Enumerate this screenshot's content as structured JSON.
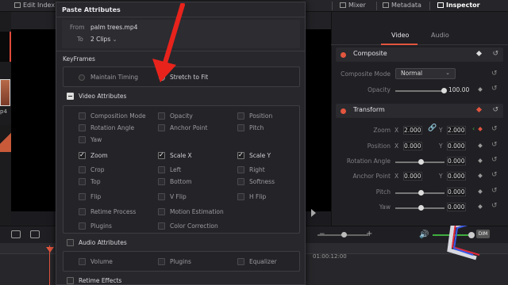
{
  "topbar": {
    "edit_index": "Edit Index",
    "mixer": "Mixer",
    "metadata": "Metadata",
    "inspector": "Inspector"
  },
  "media": {
    "clip_label": "p4"
  },
  "dialog": {
    "title": "Paste Attributes",
    "from_label": "From",
    "from_value": "palm trees.mp4",
    "to_label": "To",
    "to_value": "2 Clips",
    "keyframes_label": "KeyFrames",
    "keyframes_options": [
      {
        "label": "Maintain Timing",
        "selected": false
      },
      {
        "label": "Stretch to Fit",
        "selected": true
      }
    ],
    "video_attributes": {
      "title": "Video Attributes",
      "items": [
        {
          "label": "Composition Mode",
          "checked": false
        },
        {
          "label": "Opacity",
          "checked": false
        },
        {
          "label": "Position",
          "checked": false
        },
        {
          "label": "Rotation Angle",
          "checked": false
        },
        {
          "label": "Anchor Point",
          "checked": false
        },
        {
          "label": "Pitch",
          "checked": false
        },
        {
          "label": "Yaw",
          "checked": false
        },
        {
          "label": "Zoom",
          "checked": true
        },
        {
          "label": "Scale X",
          "checked": true
        },
        {
          "label": "Scale Y",
          "checked": true
        },
        {
          "label": "Crop",
          "checked": false
        },
        {
          "label": "Left",
          "checked": false
        },
        {
          "label": "Right",
          "checked": false
        },
        {
          "label": "Top",
          "checked": false
        },
        {
          "label": "Bottom",
          "checked": false
        },
        {
          "label": "Softness",
          "checked": false
        },
        {
          "label": "Flip",
          "checked": false
        },
        {
          "label": "V Flip",
          "checked": false
        },
        {
          "label": "H Flip",
          "checked": false
        },
        {
          "label": "Retime Process",
          "checked": false
        },
        {
          "label": "Motion Estimation",
          "checked": false
        },
        {
          "label": "Plugins",
          "checked": false
        },
        {
          "label": "Color Correction",
          "checked": false
        }
      ]
    },
    "audio_attributes": {
      "title": "Audio Attributes",
      "items": [
        {
          "label": "Volume",
          "checked": false
        },
        {
          "label": "Plugins",
          "checked": false
        },
        {
          "label": "Equalizer",
          "checked": false
        }
      ]
    },
    "retime_effects": "Retime Effects"
  },
  "inspector": {
    "tabs": [
      "Video",
      "Audio"
    ],
    "composite": {
      "title": "Composite",
      "mode_label": "Composite Mode",
      "mode_value": "Normal",
      "opacity_label": "Opacity",
      "opacity_value": "100.00"
    },
    "transform": {
      "title": "Transform",
      "zoom_label": "Zoom",
      "zoom_x": "2.000",
      "zoom_y": "2.000",
      "position_label": "Position",
      "position_x": "0.000",
      "position_y": "0.000",
      "rotation_label": "Rotation Angle",
      "rotation_value": "0.000",
      "anchor_label": "Anchor Point",
      "anchor_x": "0.000",
      "anchor_y": "0.000",
      "pitch_label": "Pitch",
      "pitch_value": "0.000",
      "yaw_label": "Yaw",
      "yaw_value": "0.000",
      "x": "X",
      "y": "Y"
    }
  },
  "timeline": {
    "timecode": "01:00:12:00",
    "dim": "DIM"
  },
  "colors": {
    "accent": "#e2553e",
    "arrow": "#e8231c"
  }
}
